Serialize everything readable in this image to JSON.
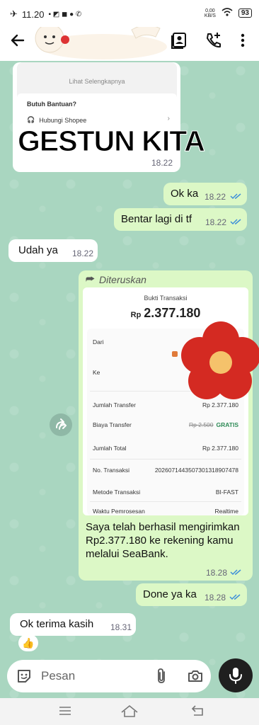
{
  "status_bar": {
    "time": "11.20",
    "net_speed": "0,00",
    "net_unit": "KB/S",
    "battery": "93"
  },
  "header": {
    "back_icon": "arrow-left-icon",
    "contact_card_icon": "contact-card-icon",
    "add_call_icon": "call-add-icon",
    "menu_icon": "more-vert-icon"
  },
  "shared_card": {
    "see_more": "Lihat Selengkapnya",
    "help_title": "Butuh Bantuan?",
    "help_link": "Hubungi Shopee",
    "time": "18.22"
  },
  "watermark": "GESTUN KITA",
  "messages": [
    {
      "text": "Ok ka",
      "time": "18.22",
      "direction": "out"
    },
    {
      "text": "Bentar lagi di tf",
      "time": "18.22",
      "direction": "out"
    },
    {
      "text": "Udah ya",
      "time": "18.22",
      "direction": "in"
    }
  ],
  "forwarded": {
    "label": "Diteruskan",
    "receipt_title": "Bukti Transaksi",
    "currency": "Rp",
    "amount": "2.377.180",
    "rows": {
      "from_label": "Dari",
      "to_label": "Ke",
      "amount_label": "Jumlah Transfer",
      "amount_value": "Rp 2.377.180",
      "fee_label": "Biaya Transfer",
      "fee_old": "Rp 2.500",
      "fee_value": "GRATIS",
      "total_label": "Jumlah Total",
      "total_value": "Rp 2.377.180",
      "txn_label": "No. Transaksi",
      "txn_value": "2026071443507301318907478",
      "method_label": "Metode Transaksi",
      "method_value": "BI-FAST",
      "proc_label": "Waktu Pemrosesan",
      "proc_value": "Realtime"
    },
    "text": "Saya telah berhasil mengirimkan Rp2.377.180 ke rekening kamu melalui SeaBank.",
    "time": "18.28"
  },
  "messages2": [
    {
      "text": "Done ya ka",
      "time": "18.28",
      "direction": "out"
    },
    {
      "text": "Ok terima kasih",
      "time": "18.31",
      "direction": "in"
    }
  ],
  "reaction": "👍",
  "input": {
    "placeholder": "Pesan"
  },
  "colors": {
    "outgoing": "#dcf8c6",
    "incoming": "#ffffff",
    "tick_blue": "#3d8fd9",
    "flower_red": "#d42a22"
  }
}
